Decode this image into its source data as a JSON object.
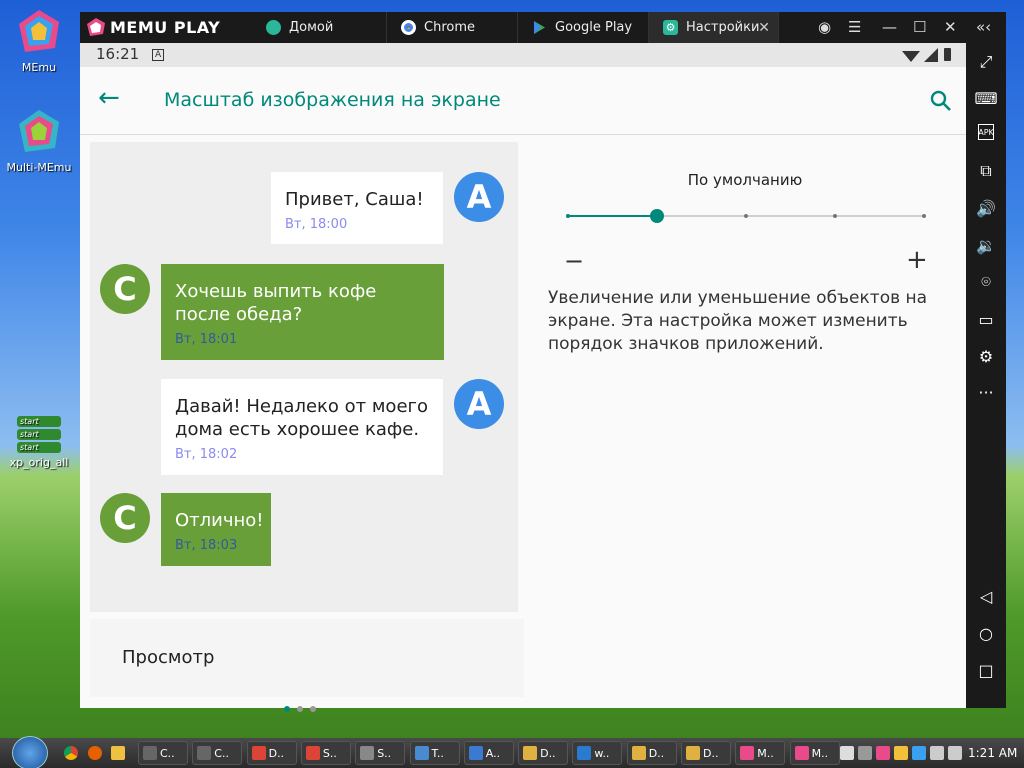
{
  "desktop": {
    "icons": [
      {
        "label": "MEmu"
      },
      {
        "label": "Multi-MEmu"
      },
      {
        "label": "xp_orig_all",
        "lines": [
          "start",
          "start",
          "start"
        ]
      }
    ]
  },
  "emulator": {
    "logo": "MEMU PLAY",
    "tabs": [
      {
        "label": "Домой"
      },
      {
        "label": "Chrome"
      },
      {
        "label": "Google Play"
      },
      {
        "label": "Настройки"
      }
    ],
    "controls": [
      "user-icon",
      "menu-icon",
      "minimize-icon",
      "maximize-icon",
      "close-icon",
      "collapse-sidebar-icon"
    ],
    "sidebar": [
      "fullscreen-icon",
      "keyboard-icon",
      "apk-icon",
      "multi-instance-icon",
      "volume-up-icon",
      "volume-down-icon",
      "location-icon",
      "folder-icon",
      "settings-icon",
      "more-icon",
      "back-icon",
      "home-icon",
      "recents-icon"
    ],
    "apk_label": "APK",
    "more_label": "···"
  },
  "android": {
    "status": {
      "time": "16:21",
      "notif": "A"
    },
    "appbar": {
      "title": "Масштаб изображения на экране"
    },
    "preview": {
      "messages": [
        {
          "from": "A",
          "text": "Привет, Саша!",
          "time": "Вт, 18:00"
        },
        {
          "from": "C",
          "text": "Хочешь выпить кофе после обеда?",
          "time": "Вт, 18:01"
        },
        {
          "from": "A",
          "text": "Давай! Недалеко от моего дома есть хорошее кафе.",
          "time": "Вт, 18:02"
        },
        {
          "from": "C",
          "text": "Отлично!",
          "time": "Вт, 18:03"
        }
      ],
      "footer_label": "Просмотр"
    },
    "scale": {
      "label": "По умолчанию",
      "minus": "−",
      "plus": "+",
      "steps": 5,
      "selected": 2,
      "description": "Увеличение или уменьшение объектов на экране. Эта настройка может изменить порядок значков приложений."
    },
    "accent": "#00897b"
  },
  "taskbar": {
    "items": [
      {
        "label": "C.."
      },
      {
        "label": "C.."
      },
      {
        "label": "D.."
      },
      {
        "label": "S.."
      },
      {
        "label": "S.."
      },
      {
        "label": "T.."
      },
      {
        "label": "A.."
      },
      {
        "label": "D.."
      },
      {
        "label": "w.."
      },
      {
        "label": "D.."
      },
      {
        "label": "D.."
      },
      {
        "label": "M.."
      },
      {
        "label": "M.."
      }
    ],
    "clock": "1:21 AM"
  }
}
